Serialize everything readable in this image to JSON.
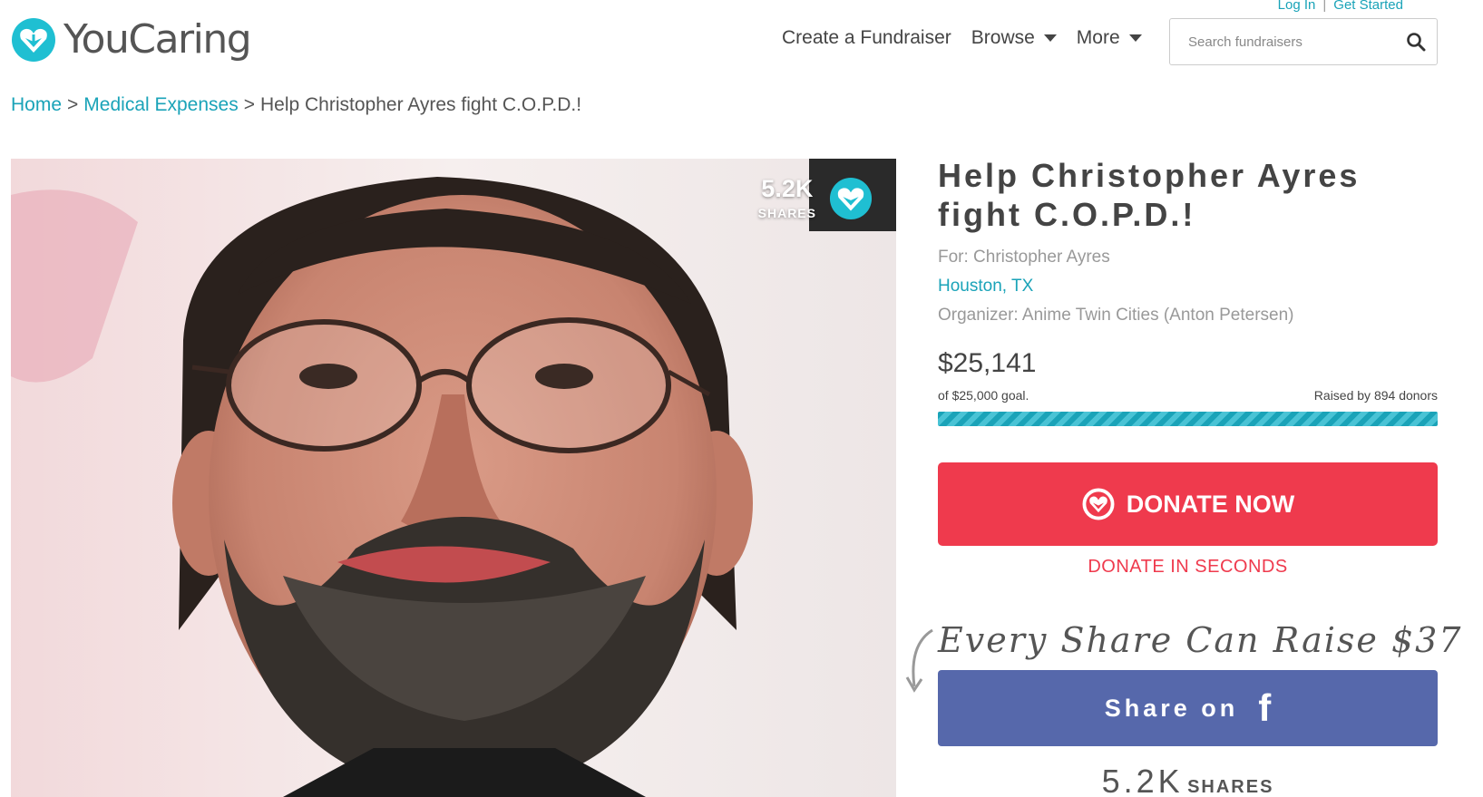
{
  "header": {
    "top_links": {
      "login": "Log In",
      "get_started": "Get Started"
    },
    "logo_text": "YouCaring",
    "nav": {
      "create": "Create a Fundraiser",
      "browse": "Browse",
      "more": "More"
    },
    "search": {
      "placeholder": "Search fundraisers"
    }
  },
  "breadcrumb": {
    "home": "Home",
    "category": "Medical Expenses",
    "current": "Help Christopher Ayres fight C.O.P.D.!",
    "separator": ">"
  },
  "hero": {
    "share_count": "5.2K",
    "share_label": "SHARES"
  },
  "campaign": {
    "title": "Help Christopher Ayres fight C.O.P.D.!",
    "for": "For: Christopher Ayres",
    "location": "Houston, TX",
    "organizer": "Organizer: Anime Twin Cities (Anton Petersen)",
    "raised": "$25,141",
    "goal": "of $25,000 goal.",
    "donors": "Raised by 894 donors",
    "progress_fraction": 1.0
  },
  "donate": {
    "button_label": "DONATE NOW",
    "subtext": "DONATE IN SECONDS"
  },
  "share": {
    "pitch": "Every Share Can Raise $37",
    "button_label": "Share on",
    "fb_glyph": "f",
    "count_big": "5.2K",
    "count_label": "SHARES"
  },
  "colors": {
    "accent": "#1aa3b8",
    "donate": "#ef3a4d",
    "facebook": "#5668ab"
  }
}
